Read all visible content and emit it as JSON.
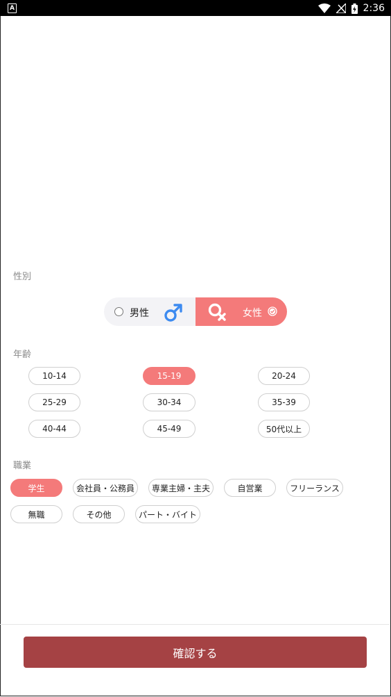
{
  "status_bar": {
    "app_badge": "A",
    "time": "2:36",
    "icons": [
      "wifi-icon",
      "signal-icon",
      "battery-icon"
    ]
  },
  "gender": {
    "label": "性別",
    "options": [
      {
        "label": "男性",
        "symbol": "male-symbol-icon",
        "selected": false
      },
      {
        "label": "女性",
        "symbol": "female-symbol-icon",
        "selected": true
      }
    ]
  },
  "age": {
    "label": "年齢",
    "options": [
      {
        "label": "10-14",
        "selected": false
      },
      {
        "label": "15-19",
        "selected": true
      },
      {
        "label": "20-24",
        "selected": false
      },
      {
        "label": "25-29",
        "selected": false
      },
      {
        "label": "30-34",
        "selected": false
      },
      {
        "label": "35-39",
        "selected": false
      },
      {
        "label": "40-44",
        "selected": false
      },
      {
        "label": "45-49",
        "selected": false
      },
      {
        "label": "50代以上",
        "selected": false
      }
    ]
  },
  "occupation": {
    "label": "職業",
    "options": [
      {
        "label": "学生",
        "selected": true
      },
      {
        "label": "会社員・公務員",
        "selected": false
      },
      {
        "label": "専業主婦・主夫",
        "selected": false
      },
      {
        "label": "自営業",
        "selected": false
      },
      {
        "label": "フリーランス",
        "selected": false
      },
      {
        "label": "無職",
        "selected": false
      },
      {
        "label": "その他",
        "selected": false
      },
      {
        "label": "パート・バイト",
        "selected": false
      }
    ]
  },
  "confirm_button": {
    "label": "確認する"
  },
  "colors": {
    "accent": "#f47a7a",
    "confirm": "#a54244",
    "male_symbol": "#3d8bf0"
  }
}
